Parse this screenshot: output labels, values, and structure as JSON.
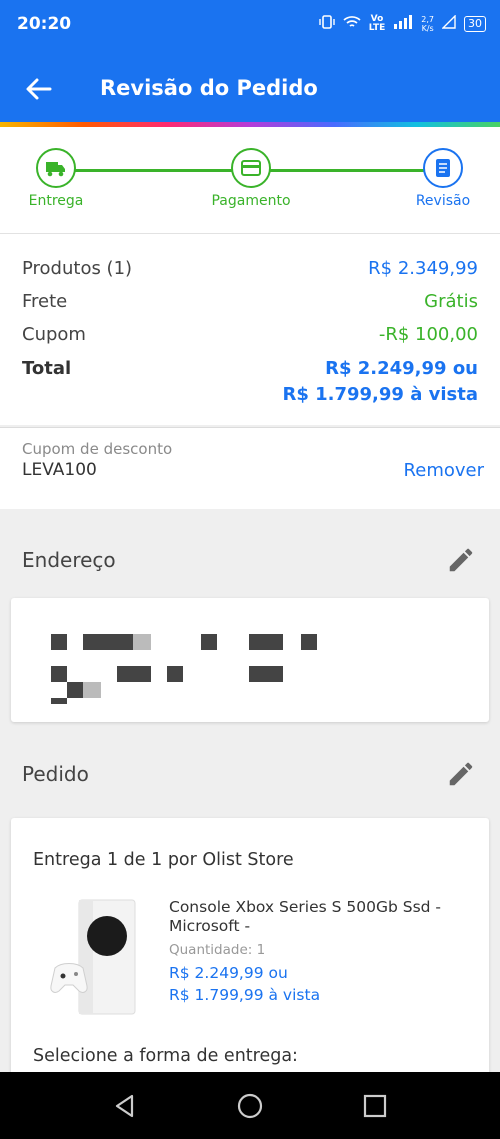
{
  "status_bar": {
    "time": "20:20",
    "network_vo": "Vo",
    "network_lte": "LTE",
    "speed_value": "2,7",
    "speed_unit": "K/s",
    "battery": "30"
  },
  "app_bar": {
    "title": "Revisão do Pedido",
    "back_icon": "arrow-left-icon"
  },
  "stepper": {
    "steps": [
      {
        "label": "Entrega",
        "icon": "truck-icon",
        "state": "done"
      },
      {
        "label": "Pagamento",
        "icon": "card-icon",
        "state": "done"
      },
      {
        "label": "Revisão",
        "icon": "document-icon",
        "state": "active"
      }
    ]
  },
  "summary": {
    "products_label": "Produtos (1)",
    "products_value": "R$ 2.349,99",
    "shipping_label": "Frete",
    "shipping_value": "Grátis",
    "coupon_label": "Cupom",
    "coupon_value": "-R$ 100,00",
    "total_label": "Total",
    "total_value": "R$ 2.249,99 ou",
    "total_cash": "R$ 1.799,99 à vista"
  },
  "coupon": {
    "caption": "Cupom de desconto",
    "code": "LEVA100",
    "remove_label": "Remover"
  },
  "address": {
    "title": "Endereço"
  },
  "order": {
    "title": "Pedido",
    "store_line": "Entrega 1 de 1 por Olist Store",
    "product_name": "Console Xbox Series S 500Gb Ssd - Microsoft -",
    "quantity": "Quantidade:  1",
    "price": "R$ 2.249,99 ou",
    "price_cash": "R$ 1.799,99 à vista",
    "shipping_select": "Selecione a forma de entrega:"
  },
  "colors": {
    "primary": "#1a73f0",
    "success": "#3ab32a"
  }
}
